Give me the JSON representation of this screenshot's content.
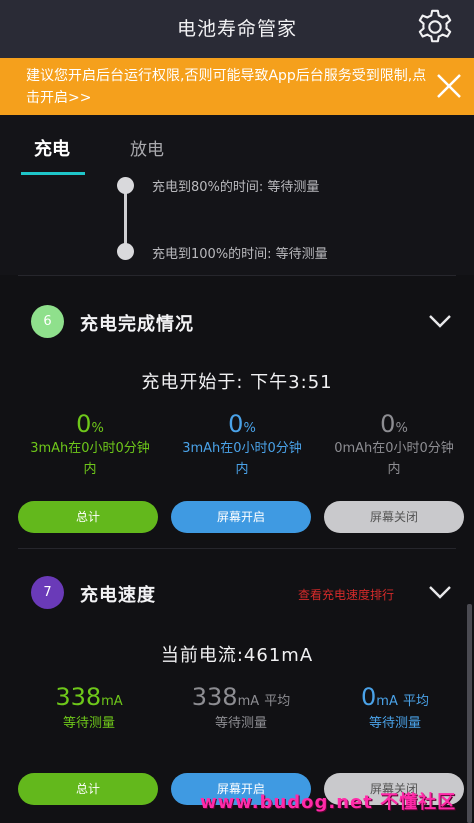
{
  "header": {
    "title": "电池寿命管家",
    "settings_icon": "gear-icon"
  },
  "banner": {
    "text": "建议您开启后台运行权限,否则可能导致App后台服务受到限制,点击开启>>",
    "close_icon": "close-icon"
  },
  "tabs": [
    {
      "label": "充电",
      "active": true
    },
    {
      "label": "放电",
      "active": false
    }
  ],
  "timeline": {
    "item_80": "充电到80%的时间: 等待测量",
    "item_100": "充电到100%的时间: 等待测量"
  },
  "charge_complete": {
    "badge": "6",
    "title": "充电完成情况",
    "start_time": "充电开始于: 下午3:51",
    "stats": [
      {
        "percent": "0",
        "unit": "%",
        "line1": "3mAh在0小时0分钟",
        "line2": "内",
        "color": "#6ec71a"
      },
      {
        "percent": "0",
        "unit": "%",
        "line1": "3mAh在0小时0分钟",
        "line2": "内",
        "color": "#4aa2e8"
      },
      {
        "percent": "0",
        "unit": "%",
        "line1": "0mAh在0小时0分钟",
        "line2": "内",
        "color": "#8d8d92"
      }
    ],
    "buttons": {
      "total": "总计",
      "screen_on": "屏幕开启",
      "screen_off": "屏幕关闭"
    }
  },
  "charge_speed": {
    "badge": "7",
    "title": "充电速度",
    "rank_link": "查看充电速度排行",
    "current": "当前电流:461mA",
    "stats": [
      {
        "value": "338",
        "unit": "mA",
        "suffix": "",
        "status": "等待测量",
        "color": "#6ec71a"
      },
      {
        "value": "338",
        "unit": "mA",
        "suffix": "平均",
        "status": "等待测量",
        "color": "#8d8d92"
      },
      {
        "value": "0",
        "unit": "mA",
        "suffix": "平均",
        "status": "等待测量",
        "color": "#4aa2e8"
      }
    ],
    "buttons": {
      "total": "总计",
      "screen_on": "屏幕开启",
      "screen_off": "屏幕关闭"
    }
  },
  "watermark": "www.budog.net 不懂社区",
  "colors": {
    "accent": "#1fc6c9",
    "banner": "#f5a01c",
    "green": "#6ec71a",
    "blue": "#4aa2e8",
    "red_link": "#d42a2a"
  }
}
